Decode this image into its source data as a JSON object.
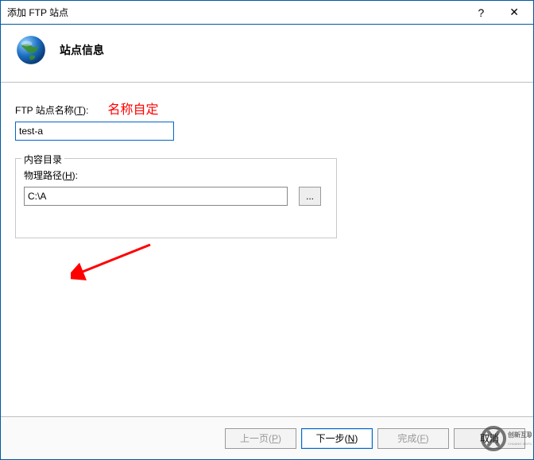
{
  "titlebar": {
    "title": "添加 FTP 站点"
  },
  "header": {
    "title": "站点信息"
  },
  "fields": {
    "site_name_label_pre": "FTP 站点名称(",
    "site_name_hotkey": "T",
    "site_name_label_post": "):",
    "site_name_value": "test-a",
    "annotation": "名称自定"
  },
  "groupbox": {
    "legend": "内容目录",
    "path_label_pre": "物理路径(",
    "path_hotkey": "H",
    "path_label_post": "):",
    "path_value": "C:\\A",
    "browse_label": "..."
  },
  "footer": {
    "prev_pre": "上一页(",
    "prev_hot": "P",
    "prev_post": ")",
    "next_pre": "下一步(",
    "next_hot": "N",
    "next_post": ")",
    "finish_pre": "完成(",
    "finish_hot": "F",
    "finish_post": ")",
    "cancel": "取消"
  }
}
